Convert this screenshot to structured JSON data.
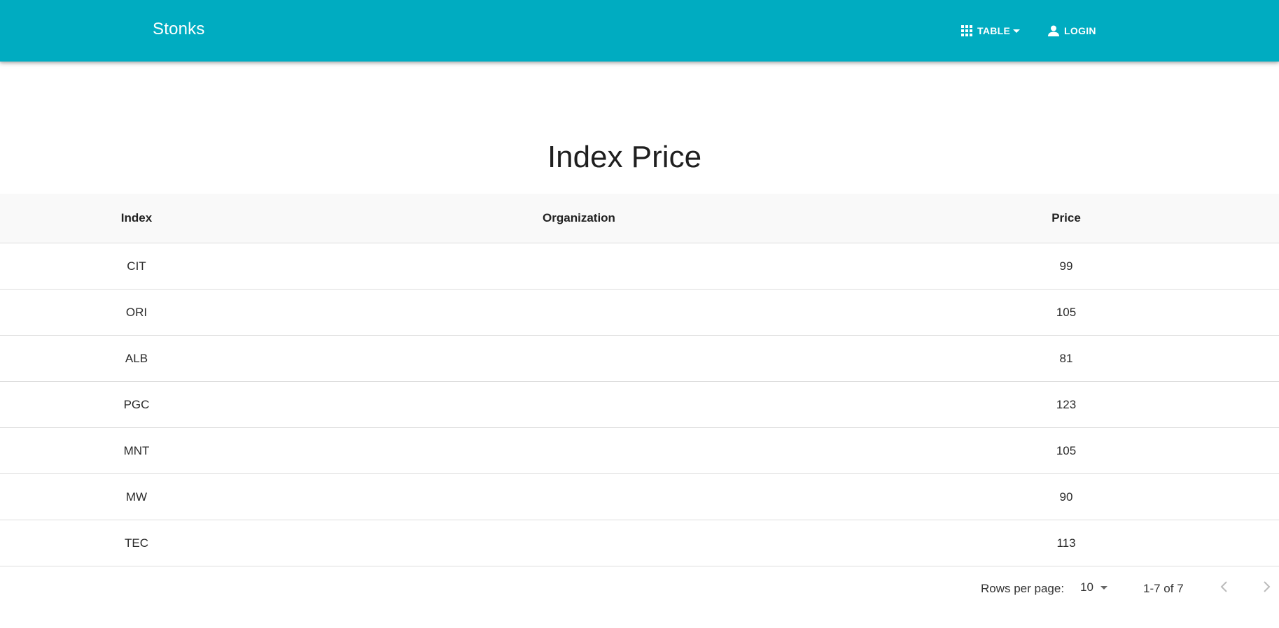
{
  "header": {
    "brand": "Stonks",
    "nav_table_label": "TABLE",
    "nav_login_label": "LOGIN"
  },
  "page": {
    "title": "Index Price"
  },
  "table": {
    "columns": [
      "Index",
      "Organization",
      "Price"
    ],
    "rows": [
      {
        "index": "CIT",
        "organization": "",
        "price": "99"
      },
      {
        "index": "ORI",
        "organization": "",
        "price": "105"
      },
      {
        "index": "ALB",
        "organization": "",
        "price": "81"
      },
      {
        "index": "PGC",
        "organization": "",
        "price": "123"
      },
      {
        "index": "MNT",
        "organization": "",
        "price": "105"
      },
      {
        "index": "MW",
        "organization": "",
        "price": "90"
      },
      {
        "index": "TEC",
        "organization": "",
        "price": "113"
      }
    ]
  },
  "pagination": {
    "rows_per_page_label": "Rows per page:",
    "rows_per_page_value": "10",
    "range_text": "1-7 of 7"
  },
  "theme": {
    "accent": "#00acc1",
    "header_bg": "#f9f9f9",
    "divider": "#dddddd"
  },
  "icons": {
    "table": "apps-grid-icon",
    "login": "person-icon",
    "dropdown": "caret-down-icon",
    "prev": "chevron-left-icon",
    "next": "chevron-right-icon"
  }
}
